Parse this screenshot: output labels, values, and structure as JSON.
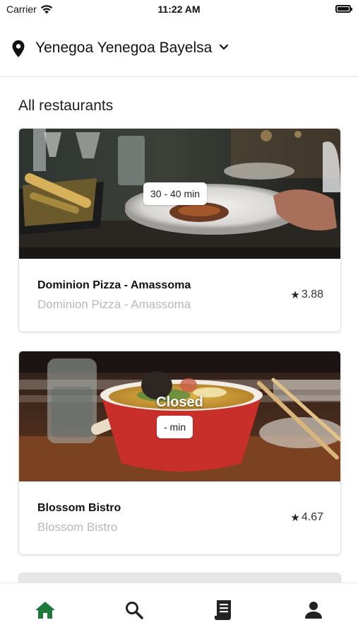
{
  "status_bar": {
    "carrier": "Carrier",
    "time": "11:22 AM",
    "icons": [
      "wifi-icon",
      "battery-icon"
    ]
  },
  "header": {
    "location": "Yenegoa Yenegoa Bayelsa",
    "icons": [
      "location-pin-icon",
      "chevron-down-icon"
    ]
  },
  "section_title": "All restaurants",
  "restaurants": [
    {
      "name": "Dominion Pizza - Amassoma",
      "subtitle": "Dominion Pizza - Amassoma",
      "delivery_time": "30 - 40 min",
      "rating": "3.88",
      "status": ""
    },
    {
      "name": "Blossom Bistro",
      "subtitle": "Blossom Bistro",
      "delivery_time": "- min",
      "rating": "4.67",
      "status": "Closed"
    }
  ],
  "tab_bar": {
    "tabs": [
      {
        "icon": "home-icon",
        "active": true
      },
      {
        "icon": "search-icon",
        "active": false
      },
      {
        "icon": "orders-icon",
        "active": false
      },
      {
        "icon": "profile-icon",
        "active": false
      }
    ]
  },
  "colors": {
    "accent": "#1b7a3a",
    "tab_inactive": "#222222",
    "subtitle": "#b8b8b8"
  }
}
